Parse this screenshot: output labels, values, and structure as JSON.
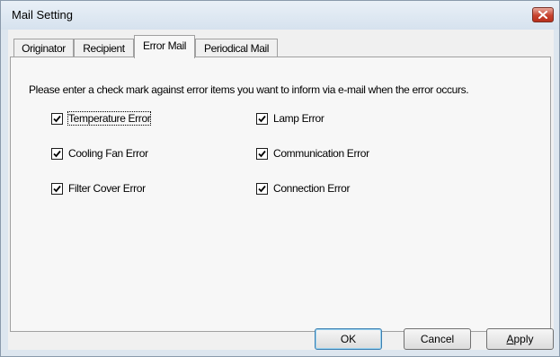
{
  "window": {
    "title": "Mail Setting",
    "close_icon": "close-x-icon"
  },
  "tabs": [
    {
      "label": "Originator",
      "active": false
    },
    {
      "label": "Recipient",
      "active": false
    },
    {
      "label": "Error Mail",
      "active": true
    },
    {
      "label": "Periodical Mail",
      "active": false
    }
  ],
  "panel": {
    "instruction": "Please enter a check mark against error items you want to inform via e-mail when the error occurs.",
    "checkboxes": [
      {
        "label": "Temperature Error",
        "checked": true
      },
      {
        "label": "Cooling Fan Error",
        "checked": true
      },
      {
        "label": "Filter Cover Error",
        "checked": true
      },
      {
        "label": "Lamp Error",
        "checked": true
      },
      {
        "label": "Communication Error",
        "checked": true
      },
      {
        "label": "Connection Error",
        "checked": true
      }
    ]
  },
  "buttons": {
    "ok": "OK",
    "cancel": "Cancel",
    "apply_mnemonic": "A",
    "apply_rest": "pply"
  }
}
